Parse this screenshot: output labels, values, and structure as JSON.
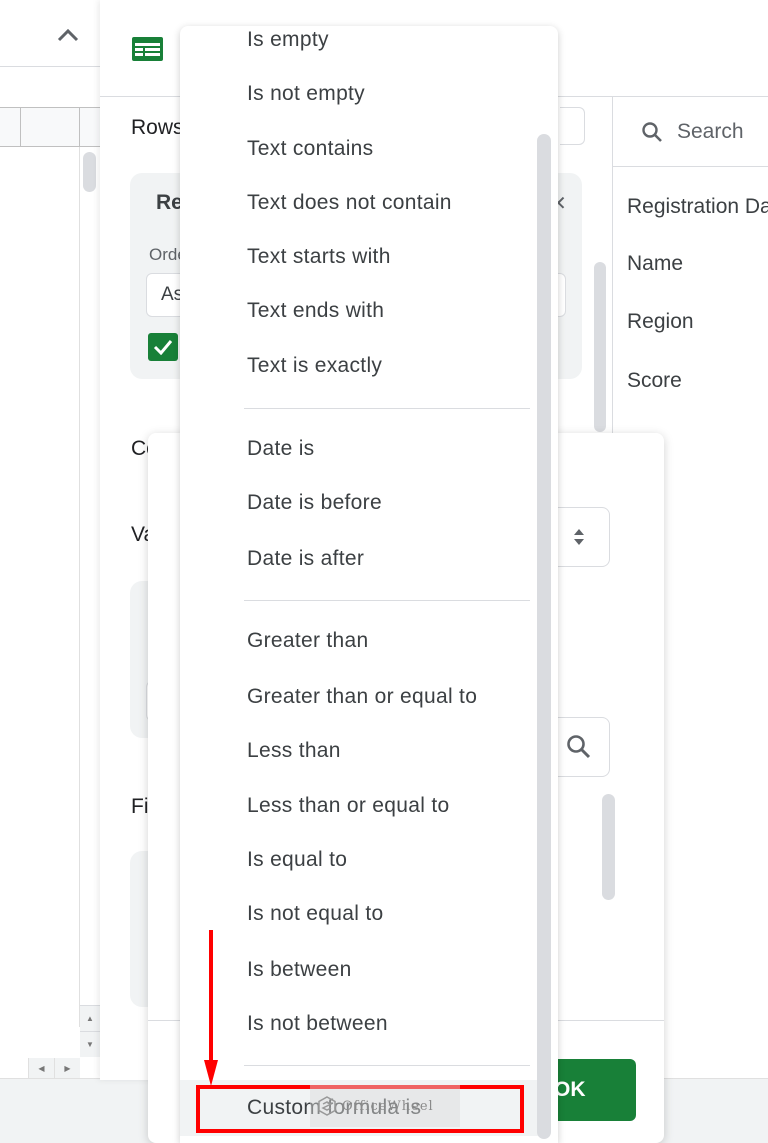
{
  "sheet": {
    "collapse_icon": "chevron-up-icon"
  },
  "editor": {
    "app_icon": "google-sheets-icon",
    "sections": {
      "rows": "Rows",
      "columns": "Columns",
      "values": "Values",
      "filters": "Filters"
    },
    "row_card": {
      "title": "Region",
      "order_label": "Order",
      "order_value": "Ascending",
      "show_totals_checked": true
    }
  },
  "field_list": {
    "search_placeholder": "Search",
    "fields": [
      "Registration Date",
      "Name",
      "Region",
      "Score"
    ]
  },
  "condition_dialog": {
    "ok_label": "OK"
  },
  "dropdown": {
    "groups": [
      [
        "Is empty",
        "Is not empty",
        "Text contains",
        "Text does not contain",
        "Text starts with",
        "Text ends with",
        "Text is exactly"
      ],
      [
        "Date is",
        "Date is before",
        "Date is after"
      ],
      [
        "Greater than",
        "Greater than or equal to",
        "Less than",
        "Less than or equal to",
        "Is equal to",
        "Is not equal to",
        "Is between",
        "Is not between"
      ],
      [
        "Custom formula is"
      ]
    ],
    "highlighted": "Custom formula is"
  },
  "annotation": {
    "color": "#ff0000",
    "watermark": "OfficeWheel"
  },
  "colors": {
    "accent_green": "#188038",
    "text": "#3c4043",
    "divider": "#dadce0"
  }
}
